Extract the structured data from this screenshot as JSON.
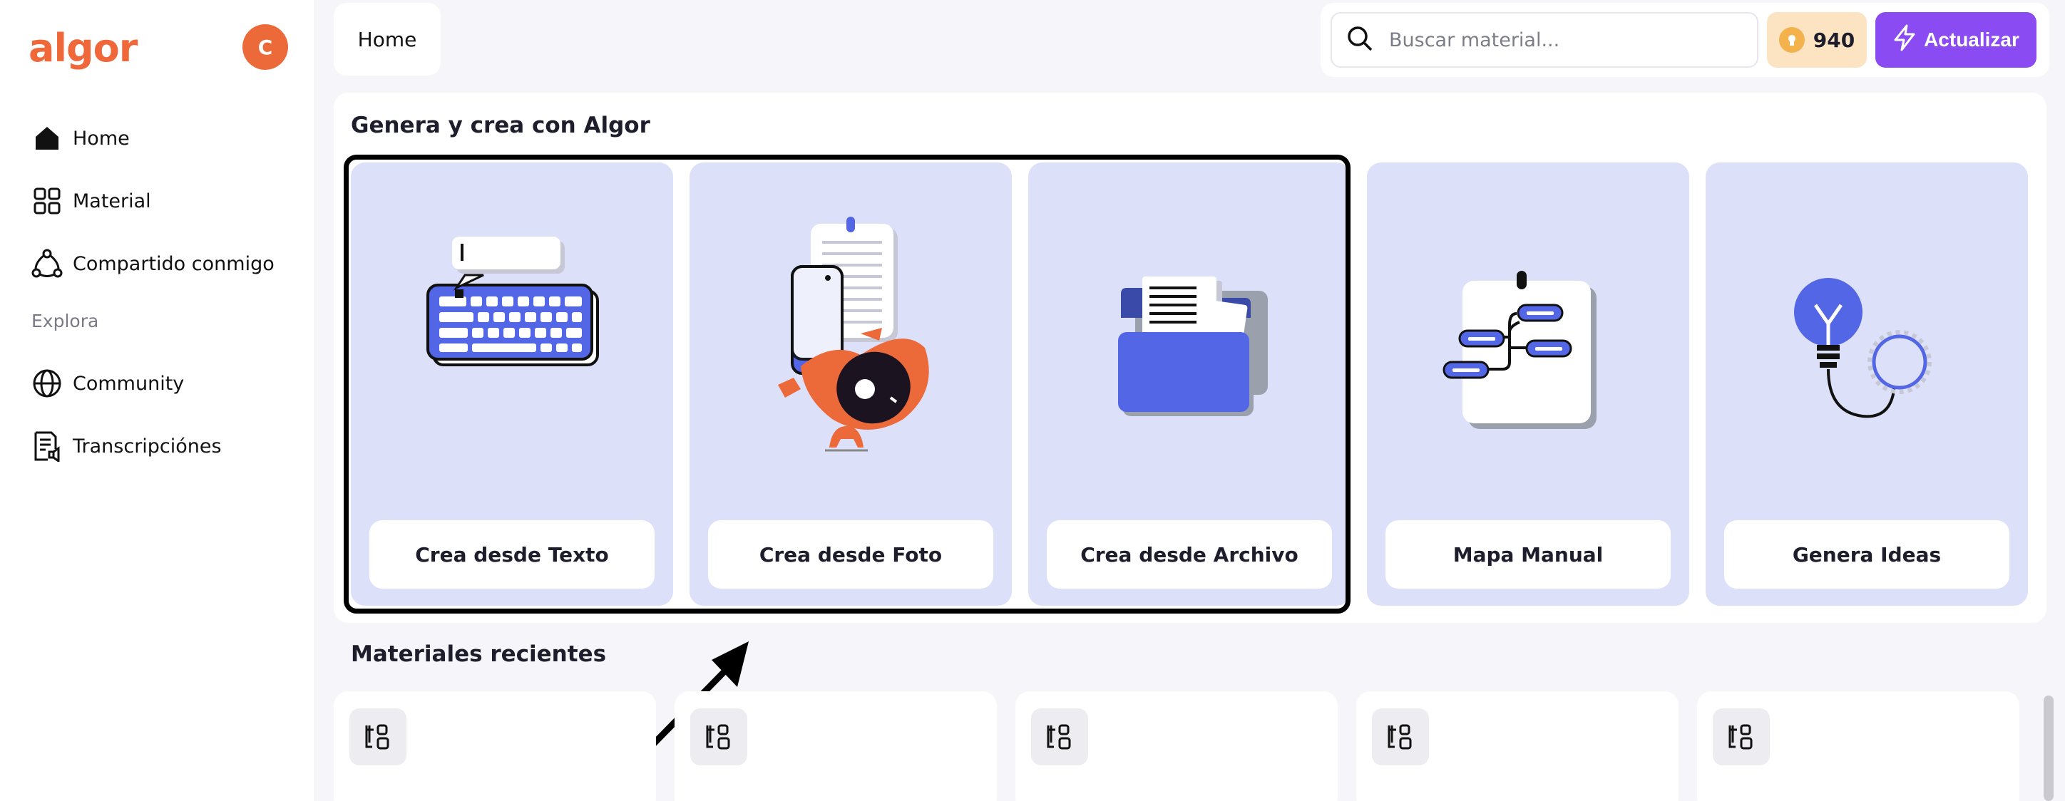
{
  "sidebar": {
    "logo": "algor",
    "avatar_initial": "C",
    "items": [
      {
        "label": "Home",
        "icon": "home-icon"
      },
      {
        "label": "Material",
        "icon": "grid-icon"
      },
      {
        "label": "Compartido conmigo",
        "icon": "share-icon"
      }
    ],
    "section_label": "Explora",
    "explore_items": [
      {
        "label": "Community",
        "icon": "globe-icon"
      },
      {
        "label": "Transcripciónes",
        "icon": "transcript-icon"
      }
    ]
  },
  "topbar": {
    "home_tab": "Home",
    "search_placeholder": "Buscar material...",
    "credits": "940",
    "upgrade_label": "Actualizar"
  },
  "generate": {
    "title": "Genera y crea con Algor",
    "cards": [
      {
        "label": "Crea desde Texto",
        "icon": "keyboard-icon"
      },
      {
        "label": "Crea desde Foto",
        "icon": "photo-robot-icon"
      },
      {
        "label": "Crea desde Archivo",
        "icon": "folder-icon"
      },
      {
        "label": "Mapa Manual",
        "icon": "mindmap-icon"
      },
      {
        "label": "Genera Ideas",
        "icon": "lightbulb-icon"
      }
    ]
  },
  "recent": {
    "title": "Materiales recientes",
    "item_icon": "mindmap-small-icon",
    "count_visible": 5
  },
  "colors": {
    "brand": "#f0683a",
    "accent_purple": "#8b4bf2",
    "card_bg": "#dce0f8",
    "credits_bg": "#fce4c2",
    "illustration_blue": "#5266e6"
  }
}
